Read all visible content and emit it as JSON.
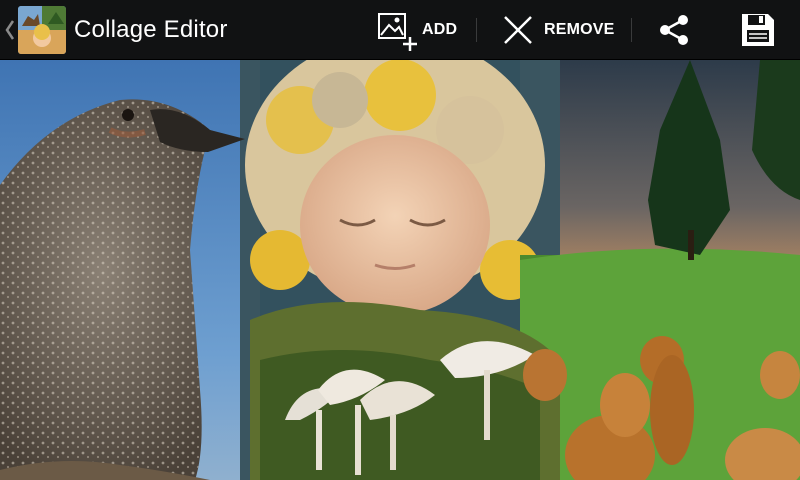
{
  "app": {
    "title": "Collage Editor"
  },
  "toolbar": {
    "add_label": "ADD",
    "remove_label": "REMOVE"
  },
  "icons": {
    "up": "chevron-left-icon",
    "app": "app-icon",
    "add": "add-image-icon",
    "remove": "close-icon",
    "share": "share-icon",
    "save": "floppy-disk-icon"
  },
  "colors": {
    "actionbar": "#111213",
    "text": "#ffffff",
    "divider": "#3a3b3c"
  }
}
